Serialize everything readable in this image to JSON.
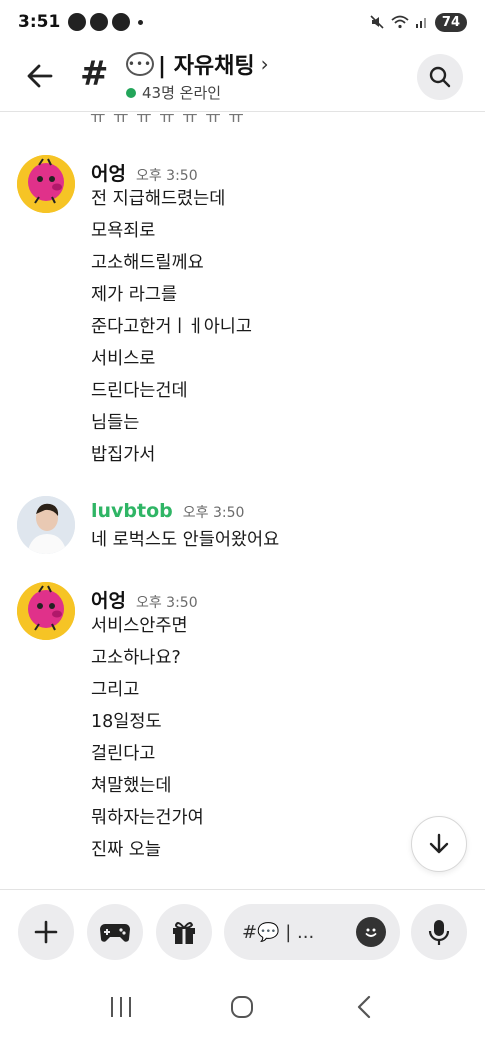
{
  "status_bar": {
    "time": "3:51",
    "battery": "74"
  },
  "header": {
    "channel_name": "| 자유채팅",
    "chevron": "›",
    "online_text": "43명 온라인"
  },
  "messages": [
    {
      "author": "어엉",
      "time": "오후 3:50",
      "avatar": "pink-character-avatar",
      "lines": [
        "전 지급해드렸는데",
        "모욕죄로",
        "고소해드릴께요",
        "제가 라그를",
        "준다고한거ㅣㅔ아니고",
        "서비스로",
        "드린다는건데",
        "님들는",
        "밥집가서"
      ]
    },
    {
      "author": "luvbtob",
      "time": "오후 3:50",
      "avatar": "photo-avatar",
      "lines": [
        "네 로벅스도 안들어왔어요"
      ]
    },
    {
      "author": "어엉",
      "time": "오후 3:50",
      "avatar": "pink-character-avatar",
      "lines": [
        "서비스안주면",
        "고소하나요?",
        "그리고",
        "18일정도",
        "걸린다고",
        "쳐말했는데",
        "뭐하자는건가여",
        "진짜 오늘"
      ]
    }
  ],
  "composer": {
    "placeholder": "#💬 | ..."
  },
  "colors": {
    "online": "#23a55a",
    "author_green": "#2fb565",
    "button_bg": "#ececee"
  }
}
